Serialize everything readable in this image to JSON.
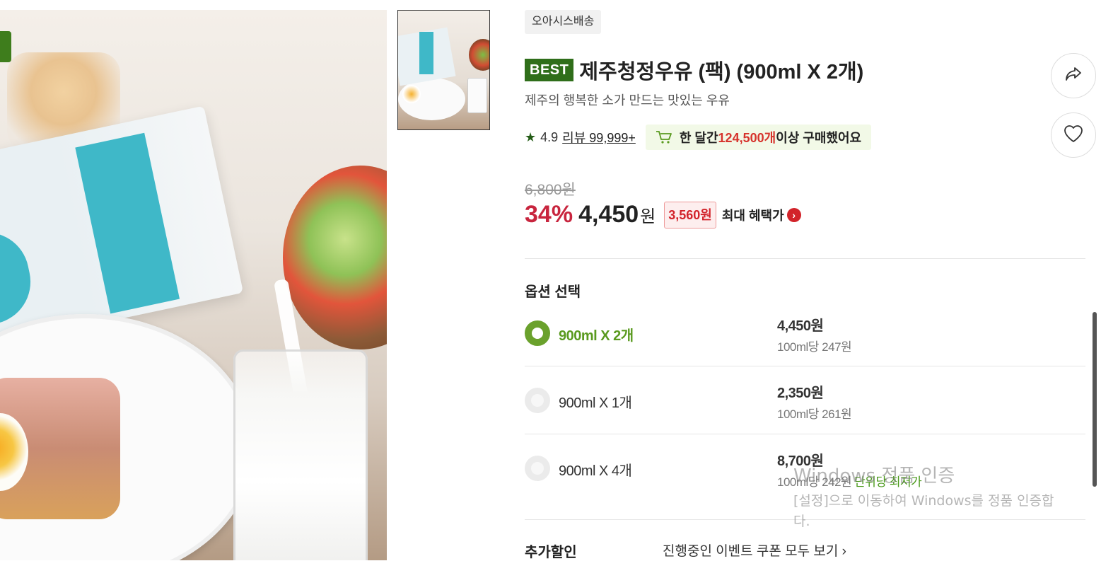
{
  "product": {
    "delivery_tag": "오아시스배송",
    "best_badge": "BEST",
    "title": "제주청정우유 (팩) (900ml X 2개)",
    "subtitle": "제주의 행복한 소가 만드는 맛있는 우유",
    "rating": "4.9",
    "review_link": "리뷰 99,999+",
    "purchase_prefix": "한 달간 ",
    "purchase_count": "124,500개",
    "purchase_suffix": " 이상 구매했어요"
  },
  "price": {
    "original": "6,800원",
    "discount": "34%",
    "current": "4,450",
    "won": "원",
    "coupon": "3,560원",
    "max_benefit": "최대 혜택가",
    "max_arrow": "›"
  },
  "options": {
    "header": "옵션 선택",
    "items": [
      {
        "label": "900ml X 2개",
        "price": "4,450원",
        "unit": "100ml당 247원",
        "badge": "",
        "selected": true
      },
      {
        "label": "900ml X 1개",
        "price": "2,350원",
        "unit": "100ml당 261원",
        "badge": "",
        "selected": false
      },
      {
        "label": "900ml X 4개",
        "price": "8,700원",
        "unit": "100ml당 242원",
        "badge": "단위당 최저가",
        "selected": false
      }
    ]
  },
  "additional": {
    "label": "추가할인",
    "link": "진행중인 이벤트 쿠폰 모두 보기 ›"
  },
  "icons": [
    "share-icon",
    "heart-icon",
    "star-icon",
    "cart-icon"
  ],
  "colors": {
    "accent_green": "#2f6e1a",
    "option_green": "#6aa12c",
    "discount_red": "#c8253e"
  },
  "watermark": {
    "line1": "Windows 정품 인증",
    "line2": "[설정]으로 이동하여 Windows를 정품 인증합",
    "line3": "다."
  }
}
